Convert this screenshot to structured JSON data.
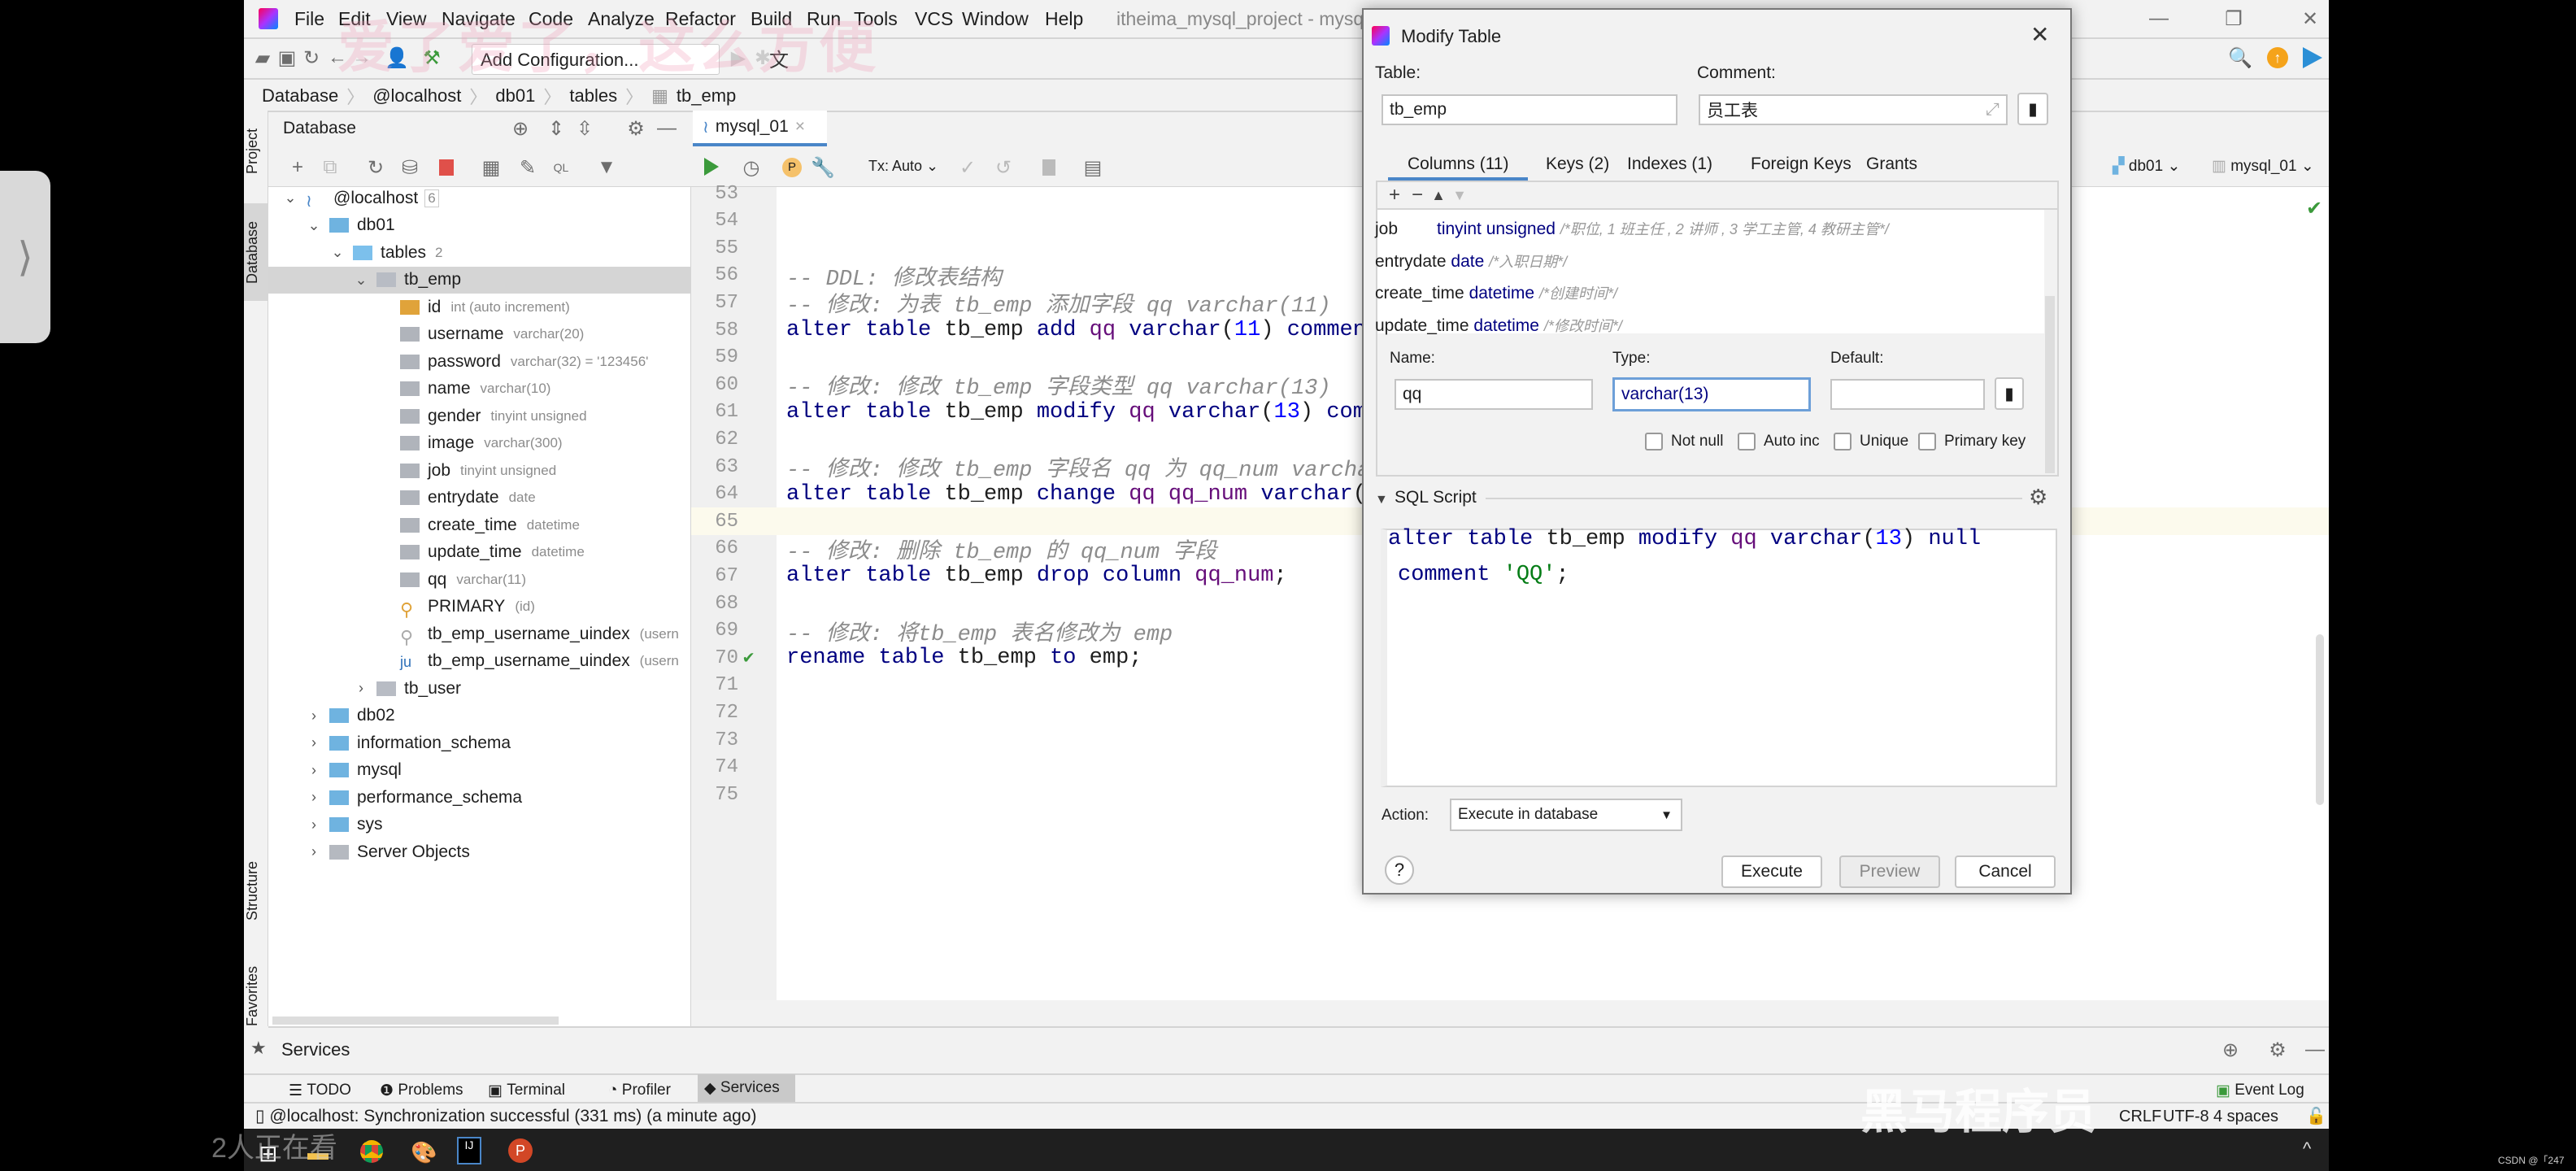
{
  "menu": {
    "items": [
      "File",
      "Edit",
      "View",
      "Navigate",
      "Code",
      "Analyze",
      "Refactor",
      "Build",
      "Run",
      "Tools",
      "VCS",
      "Window",
      "Help"
    ],
    "title": "itheima_mysql_project - mysql"
  },
  "toolbar": {
    "run_config": "Add Configuration..."
  },
  "breadcrumb": [
    "Database",
    "@localhost",
    "db01",
    "tables",
    "tb_emp"
  ],
  "db_panel": {
    "title": "Database",
    "tree": [
      {
        "label": "@localhost",
        "type": "6",
        "kind": "host",
        "depth": 0,
        "chev": "open"
      },
      {
        "label": "db01",
        "type": "",
        "kind": "schema",
        "depth": 1,
        "chev": "open"
      },
      {
        "label": "tables",
        "type": "2",
        "kind": "folder",
        "depth": 2,
        "chev": "open"
      },
      {
        "label": "tb_emp",
        "type": "",
        "kind": "table",
        "depth": 3,
        "chev": "open",
        "selected": true
      },
      {
        "label": "id",
        "type": "int (auto increment)",
        "kind": "pkcol",
        "depth": 4
      },
      {
        "label": "username",
        "type": "varchar(20)",
        "kind": "col",
        "depth": 4
      },
      {
        "label": "password",
        "type": "varchar(32) = '123456'",
        "kind": "col",
        "depth": 4
      },
      {
        "label": "name",
        "type": "varchar(10)",
        "kind": "col",
        "depth": 4
      },
      {
        "label": "gender",
        "type": "tinyint unsigned",
        "kind": "col",
        "depth": 4
      },
      {
        "label": "image",
        "type": "varchar(300)",
        "kind": "col",
        "depth": 4
      },
      {
        "label": "job",
        "type": "tinyint unsigned",
        "kind": "col",
        "depth": 4
      },
      {
        "label": "entrydate",
        "type": "date",
        "kind": "col",
        "depth": 4
      },
      {
        "label": "create_time",
        "type": "datetime",
        "kind": "col",
        "depth": 4
      },
      {
        "label": "update_time",
        "type": "datetime",
        "kind": "col",
        "depth": 4
      },
      {
        "label": "qq",
        "type": "varchar(11)",
        "kind": "col",
        "depth": 4
      },
      {
        "label": "PRIMARY",
        "type": "(id)",
        "kind": "key",
        "depth": 4
      },
      {
        "label": "tb_emp_username_uindex",
        "type": "(usern",
        "kind": "ukey",
        "depth": 4
      },
      {
        "label": "tb_emp_username_uindex",
        "type": "(usern",
        "kind": "index",
        "depth": 4
      },
      {
        "label": "tb_user",
        "type": "",
        "kind": "table",
        "depth": 3,
        "chev": "closed"
      },
      {
        "label": "db02",
        "type": "",
        "kind": "schema",
        "depth": 1,
        "chev": "closed"
      },
      {
        "label": "information_schema",
        "type": "",
        "kind": "schema",
        "depth": 1,
        "chev": "closed"
      },
      {
        "label": "mysql",
        "type": "",
        "kind": "schema",
        "depth": 1,
        "chev": "closed"
      },
      {
        "label": "performance_schema",
        "type": "",
        "kind": "schema",
        "depth": 1,
        "chev": "closed"
      },
      {
        "label": "sys",
        "type": "",
        "kind": "schema",
        "depth": 1,
        "chev": "closed"
      },
      {
        "label": "Server Objects",
        "type": "",
        "kind": "gfolder",
        "depth": 1,
        "chev": "closed"
      }
    ]
  },
  "side_tabs": [
    "Project",
    "Database",
    "Structure",
    "Favorites"
  ],
  "editor": {
    "tab": "mysql_01",
    "tx": "Tx: Auto",
    "schema": "db01",
    "datasource": "mysql_01",
    "lines": [
      {
        "n": "53",
        "t": []
      },
      {
        "n": "54",
        "t": []
      },
      {
        "n": "55",
        "t": []
      },
      {
        "n": "56",
        "t": [
          [
            "-- DDL: 修改表结构",
            "c"
          ]
        ]
      },
      {
        "n": "57",
        "t": [
          [
            "-- 修改: 为表 tb_emp 添加字段 qq varchar(11)",
            "c"
          ]
        ]
      },
      {
        "n": "58",
        "t": [
          [
            "alter table ",
            "k"
          ],
          [
            "tb_emp ",
            ""
          ],
          [
            "add ",
            "k"
          ],
          [
            "qq ",
            "f"
          ],
          [
            "varchar",
            "k"
          ],
          [
            "(",
            ""
          ],
          [
            "11",
            "n"
          ],
          [
            ") ",
            ""
          ],
          [
            "comment",
            "k"
          ]
        ]
      },
      {
        "n": "59",
        "t": []
      },
      {
        "n": "60",
        "t": [
          [
            "-- 修改: 修改 tb_emp 字段类型 qq varchar(13)",
            "c"
          ]
        ]
      },
      {
        "n": "61",
        "t": [
          [
            "alter table ",
            "k"
          ],
          [
            "tb_emp ",
            ""
          ],
          [
            "modify ",
            "k"
          ],
          [
            "qq ",
            "f"
          ],
          [
            "varchar",
            "k"
          ],
          [
            "(",
            ""
          ],
          [
            "13",
            "n"
          ],
          [
            ") ",
            ""
          ],
          [
            "comm",
            "k"
          ]
        ]
      },
      {
        "n": "62",
        "t": []
      },
      {
        "n": "63",
        "t": [
          [
            "-- 修改: 修改 tb_emp 字段名 qq 为 qq_num varcha",
            "c"
          ]
        ]
      },
      {
        "n": "64",
        "t": [
          [
            "alter table ",
            "k"
          ],
          [
            "tb_emp ",
            ""
          ],
          [
            "change ",
            "k"
          ],
          [
            "qq qq_num ",
            "f"
          ],
          [
            "varchar",
            "k"
          ],
          [
            "(",
            ""
          ]
        ]
      },
      {
        "n": "65",
        "t": [],
        "current": true
      },
      {
        "n": "66",
        "t": [
          [
            "-- 修改: 删除 tb_emp 的 qq_num 字段",
            "c"
          ]
        ]
      },
      {
        "n": "67",
        "t": [
          [
            "alter table ",
            "k"
          ],
          [
            "tb_emp ",
            ""
          ],
          [
            "drop column ",
            "k"
          ],
          [
            "qq_num",
            "f"
          ],
          [
            ";",
            ""
          ]
        ]
      },
      {
        "n": "68",
        "t": []
      },
      {
        "n": "69",
        "t": [
          [
            "-- 修改: 将tb_emp 表名修改为 emp",
            "c"
          ]
        ]
      },
      {
        "n": "70",
        "t": [
          [
            "rename table ",
            "k"
          ],
          [
            "tb_emp ",
            ""
          ],
          [
            "to ",
            "k"
          ],
          [
            "emp;",
            ""
          ]
        ],
        "check": true
      },
      {
        "n": "71",
        "t": []
      },
      {
        "n": "72",
        "t": []
      },
      {
        "n": "73",
        "t": []
      },
      {
        "n": "74",
        "t": []
      },
      {
        "n": "75",
        "t": []
      }
    ]
  },
  "dialog": {
    "title": "Modify Table",
    "table_label": "Table:",
    "table_value": "tb_emp",
    "comment_label": "Comment:",
    "comment_value": "员工表",
    "tabs": [
      "Columns (11)",
      "Keys (2)",
      "Indexes (1)",
      "Foreign Keys",
      "Grants"
    ],
    "columns": [
      {
        "name": "job",
        "type": "tinyint unsigned",
        "comment": "/*职位, 1 班主任 , 2 讲师 , 3 学工主管, 4 教研主管*/"
      },
      {
        "name": "entrydate",
        "type": "date",
        "comment": "/*入职日期*/"
      },
      {
        "name": "create_time",
        "type": "datetime",
        "comment": "/*创建时间*/"
      },
      {
        "name": "update_time",
        "type": "datetime",
        "comment": "/*修改时间*/"
      }
    ],
    "name_label": "Name:",
    "name_value": "qq",
    "type_label": "Type:",
    "type_value": "varchar(13)",
    "default_label": "Default:",
    "default_value": "",
    "checks": [
      {
        "label": "Not null",
        "checked": false
      },
      {
        "label": "Auto inc",
        "checked": false
      },
      {
        "label": "Unique",
        "checked": false
      },
      {
        "label": "Primary key",
        "checked": false
      }
    ],
    "sql_label": "SQL Script",
    "sql": [
      [
        [
          "alter table ",
          "k"
        ],
        [
          "tb_emp ",
          ""
        ],
        [
          "modify ",
          "k"
        ],
        [
          "qq ",
          "f"
        ],
        [
          "varchar",
          "k"
        ],
        [
          "(",
          ""
        ],
        [
          "13",
          "n"
        ],
        [
          ") ",
          ""
        ],
        [
          "null",
          "k"
        ]
      ],
      [
        [
          "comment ",
          "k"
        ],
        [
          "'QQ'",
          "s"
        ],
        [
          ";",
          ""
        ]
      ]
    ],
    "action_label": "Action:",
    "action_value": "Execute in database",
    "execute": "Execute",
    "preview": "Preview",
    "cancel": "Cancel",
    "help": "?"
  },
  "services": {
    "title": "Services"
  },
  "bottom_tabs": [
    "TODO",
    "Problems",
    "Terminal",
    "Profiler",
    "Services"
  ],
  "status": {
    "message": "@localhost: Synchronization successful (331 ms) (a minute ago)",
    "event_log": "Event Log",
    "line_sep": "CRLF",
    "encoding": "UTF-8",
    "indent": "4 spaces"
  },
  "watermarks": {
    "top": "爱了爱了，这么方便",
    "bottom": "黑马程序员",
    "viewers": "2人正在看",
    "csdn": "CSDN @「247"
  },
  "colors": {
    "accent": "#4a86c8",
    "selection": "#d5d5d5",
    "run": "#3b9a3b",
    "stop": "#e0504a"
  }
}
